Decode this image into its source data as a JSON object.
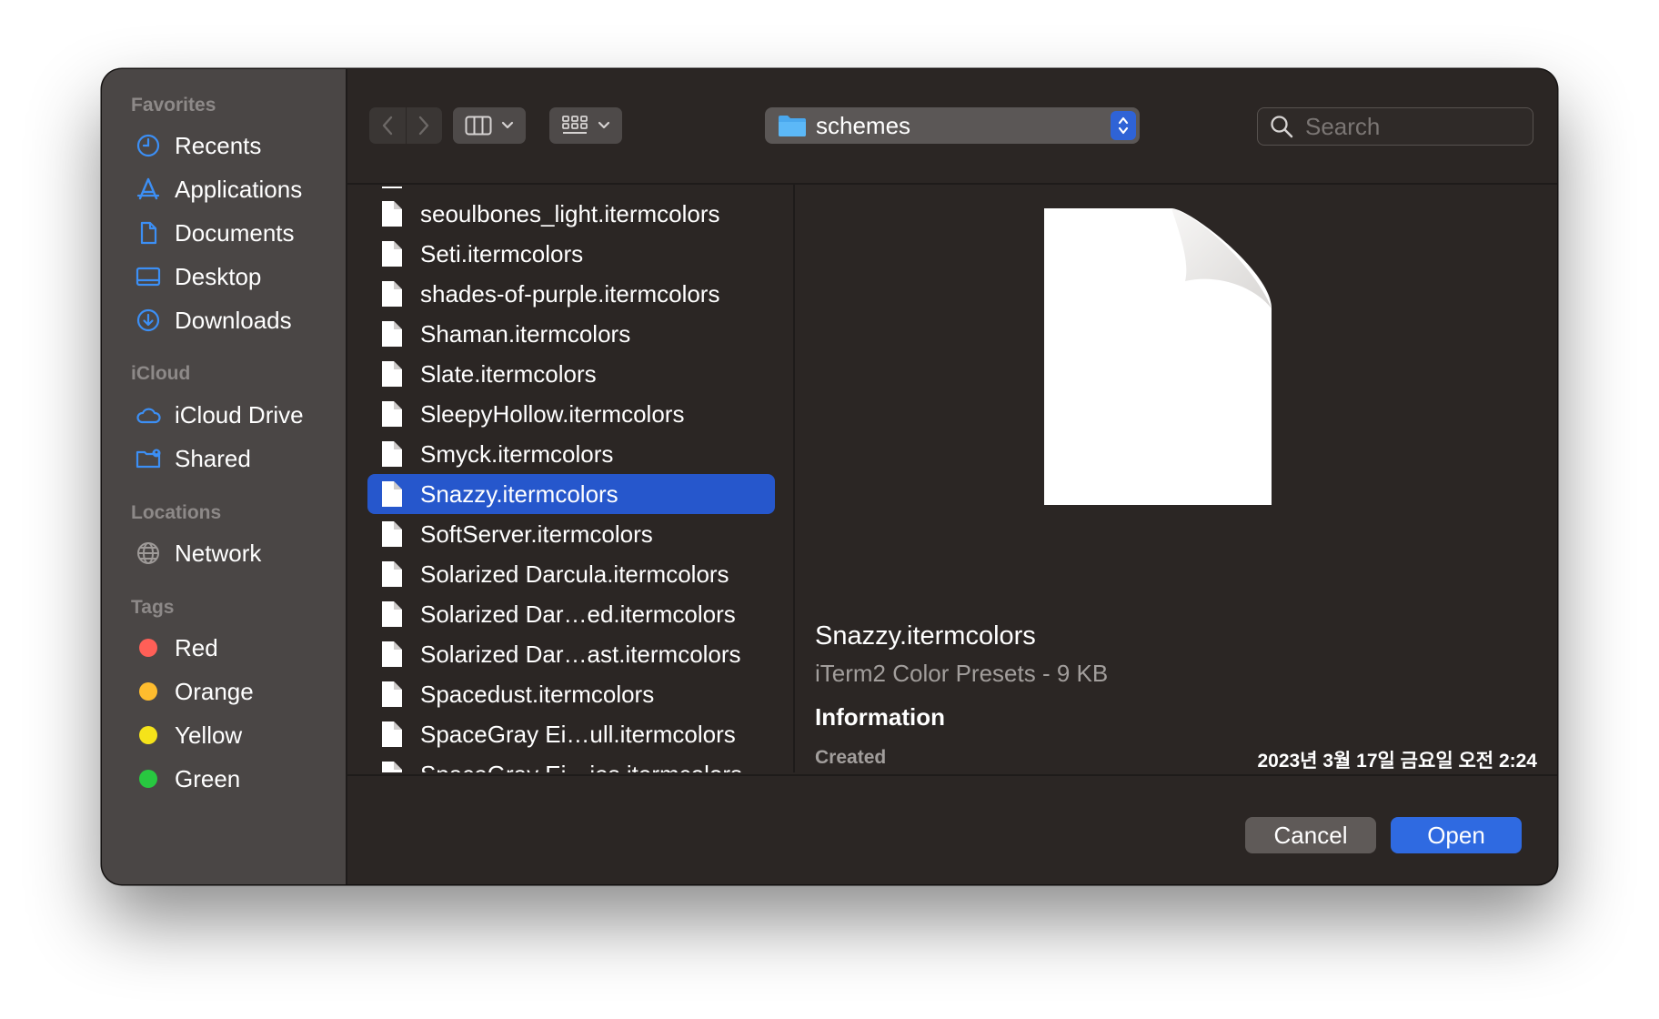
{
  "sidebar": {
    "favorites_title": "Favorites",
    "favorites": [
      {
        "label": "Recents",
        "icon": "clock-icon"
      },
      {
        "label": "Applications",
        "icon": "applications-icon"
      },
      {
        "label": "Documents",
        "icon": "document-icon"
      },
      {
        "label": "Desktop",
        "icon": "desktop-icon"
      },
      {
        "label": "Downloads",
        "icon": "download-icon"
      }
    ],
    "icloud_title": "iCloud",
    "icloud": [
      {
        "label": "iCloud Drive",
        "icon": "cloud-icon"
      },
      {
        "label": "Shared",
        "icon": "shared-folder-icon"
      }
    ],
    "locations_title": "Locations",
    "locations": [
      {
        "label": "Network",
        "icon": "globe-icon"
      }
    ],
    "tags_title": "Tags",
    "tags": [
      {
        "label": "Red",
        "color": "#ff5f57"
      },
      {
        "label": "Orange",
        "color": "#febc2e"
      },
      {
        "label": "Yellow",
        "color": "#f5e31a"
      },
      {
        "label": "Green",
        "color": "#28c840"
      }
    ]
  },
  "toolbar": {
    "path": "schemes",
    "search_placeholder": "Search"
  },
  "files": [
    {
      "name": "seoulbones_light.itermcolors",
      "selected": false
    },
    {
      "name": "Seti.itermcolors",
      "selected": false
    },
    {
      "name": "shades-of-purple.itermcolors",
      "selected": false
    },
    {
      "name": "Shaman.itermcolors",
      "selected": false
    },
    {
      "name": "Slate.itermcolors",
      "selected": false
    },
    {
      "name": "SleepyHollow.itermcolors",
      "selected": false
    },
    {
      "name": "Smyck.itermcolors",
      "selected": false
    },
    {
      "name": "Snazzy.itermcolors",
      "selected": true
    },
    {
      "name": "SoftServer.itermcolors",
      "selected": false
    },
    {
      "name": "Solarized Darcula.itermcolors",
      "selected": false
    },
    {
      "name": "Solarized Dar…ed.itermcolors",
      "selected": false
    },
    {
      "name": "Solarized Dar…ast.itermcolors",
      "selected": false
    },
    {
      "name": "Spacedust.itermcolors",
      "selected": false
    },
    {
      "name": "SpaceGray Ei…ull.itermcolors",
      "selected": false
    },
    {
      "name": "SpaceGray Ei…ies.itermcolors",
      "selected": false
    }
  ],
  "preview": {
    "name": "Snazzy.itermcolors",
    "kind": "iTerm2 Color Presets - 9 KB",
    "info_title": "Information",
    "created_label": "Created",
    "created_value": "2023년 3월 17일 금요일 오전 2:24"
  },
  "buttons": {
    "cancel": "Cancel",
    "open": "Open"
  },
  "colors": {
    "accent": "#2f6ae1",
    "selection": "#2657cc",
    "sidebar_icon": "#3c8ff5"
  }
}
